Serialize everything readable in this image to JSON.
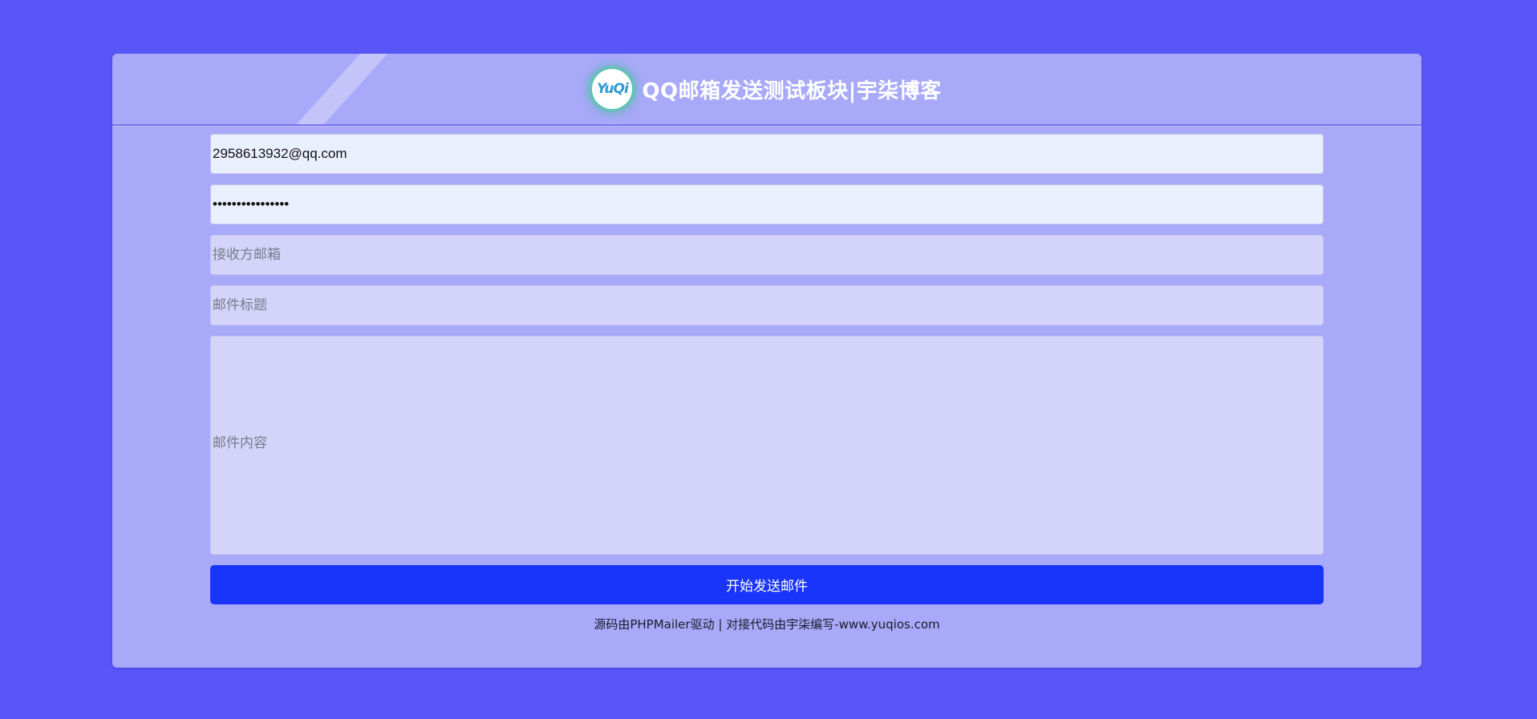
{
  "header": {
    "logo_text": "YuQi",
    "title": "QQ邮箱发送测试板块|宇柒博客"
  },
  "form": {
    "sender_email": {
      "value": "2958613932@qq.com",
      "placeholder": ""
    },
    "password": {
      "value": "1234567890123456",
      "placeholder": ""
    },
    "recipient": {
      "value": "",
      "placeholder": "接收方邮箱"
    },
    "subject": {
      "value": "",
      "placeholder": "邮件标题"
    },
    "content": {
      "value": "",
      "placeholder": "邮件内容"
    },
    "submit_label": "开始发送邮件"
  },
  "footer": {
    "note": "源码由PHPMailer驱动 | 对接代码由宇柒编写-www.yuqios.com"
  },
  "colors": {
    "page_bg": "#5856f7",
    "card_bg": "#a9a9f9",
    "button_bg": "#1a35fb",
    "input_filled_bg": "#e9effd",
    "input_empty_bg": "#d4d4fb"
  }
}
